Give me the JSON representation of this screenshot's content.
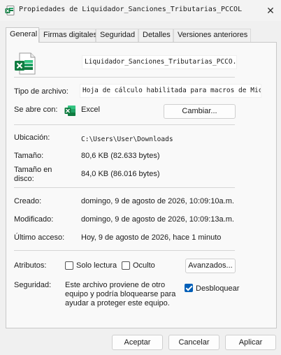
{
  "window": {
    "title": "Propiedades de Liquidador_Sanciones_Tributarias_PCCOL",
    "close_glyph": "✕"
  },
  "tabs": [
    {
      "label": "General",
      "active": true
    },
    {
      "label": "Firmas digitales"
    },
    {
      "label": "Seguridad"
    },
    {
      "label": "Detalles"
    },
    {
      "label": "Versiones anteriores"
    }
  ],
  "general": {
    "file_name": "Liquidador_Sanciones_Tributarias_PCCO...",
    "file_type_label": "Tipo de archivo:",
    "file_type_value": "Hoja de cálculo habilitada para macros de Micro...",
    "opens_with_label": "Se abre con:",
    "opens_with_value": "Excel",
    "change_button": "Cambiar...",
    "location_label": "Ubicación:",
    "location_value": "C:\\Users\\User\\Downloads",
    "size_label": "Tamaño:",
    "size_value": "80,6 KB (82.633 bytes)",
    "size_on_disk_label_1": "Tamaño en",
    "size_on_disk_label_2": "disco:",
    "size_on_disk_value": "84,0 KB (86.016 bytes)",
    "created_label": "Creado:",
    "created_value": "domingo, 9 de agosto de 2026, 10:09:10a.m.",
    "modified_label": "Modificado:",
    "modified_value": "domingo, 9 de agosto de 2026, 10:09:13a.m.",
    "accessed_label": "Último acceso:",
    "accessed_value": "Hoy, 9 de agosto de 2026, hace 1 minuto",
    "attributes_label": "Atributos:",
    "readonly_label": "Solo lectura",
    "readonly_checked": false,
    "hidden_label": "Oculto",
    "hidden_checked": false,
    "advanced_button": "Avanzados...",
    "security_label": "Seguridad:",
    "security_text_1": "Este archivo proviene de otro",
    "security_text_2": "equipo y podría bloquearse para",
    "security_text_3": "ayudar a proteger este equipo.",
    "unblock_label": "Desbloquear",
    "unblock_checked": true
  },
  "footer": {
    "accept": "Aceptar",
    "cancel": "Cancelar",
    "apply": "Aplicar"
  },
  "colors": {
    "excel_green": "#107c41",
    "accent_blue": "#005fb8"
  },
  "icons": {
    "title": "excel-file-icon",
    "file": "excel-file-icon",
    "opens_with": "excel-app-icon",
    "close": "close-icon"
  }
}
